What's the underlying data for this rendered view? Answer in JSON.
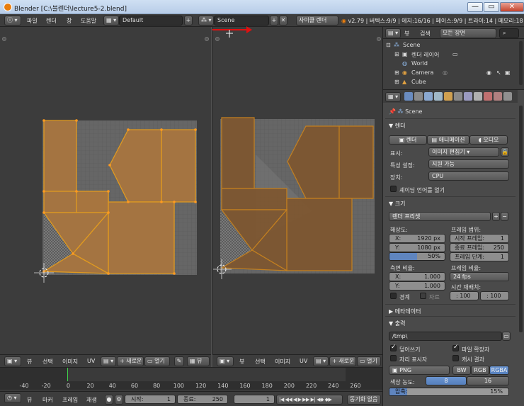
{
  "window": {
    "title": "Blender [C:\\블렌더\\lecture5-2.blend]",
    "min": "—",
    "max": "▭",
    "close": "✕"
  },
  "info": {
    "menu": [
      "파일",
      "렌더",
      "창",
      "도움말"
    ],
    "screen_layout": "Default",
    "scene": "Scene",
    "engine": "사이클 렌더",
    "stats": "v2.79 | 버텍스:9/9 | 에지:16/16 | 페이스:9/9 | 트라이:14 | 메모리:18"
  },
  "viewport_left": {
    "menu": [
      "뷰",
      "선택",
      "이미지",
      "UV"
    ],
    "new_label": "새로운",
    "open_label": "열기"
  },
  "viewport_right": {
    "view_label": "뷰",
    "new_label": "새로운",
    "open_label": "열기"
  },
  "timeline": {
    "ticks": [
      "-40",
      "-20",
      "0",
      "20",
      "40",
      "60",
      "80",
      "100",
      "120",
      "140",
      "160",
      "180",
      "200",
      "220",
      "240",
      "260"
    ],
    "menu": [
      "뷰",
      "마커",
      "프레임",
      "재생"
    ],
    "start_label": "시작:",
    "start_value": "1",
    "end_label": "종료:",
    "end_value": "250",
    "current_value": "1",
    "sync": "동기화 없음"
  },
  "outliner": {
    "view": "뷰",
    "search": "검색",
    "filter": "모든 장면",
    "rows": [
      "Scene",
      "렌더 레이어",
      "World",
      "Camera",
      "Cube"
    ]
  },
  "properties": {
    "context": "Scene",
    "render_panel": "렌더",
    "render_btn": "렌더",
    "anim_btn": "애니메이션",
    "audio_btn": "오디오",
    "display_label": "표시:",
    "display_value": "이미지 편집기",
    "feature_label": "특성 설정:",
    "feature_value": "지원 가능",
    "device_label": "장치:",
    "device_value": "CPU",
    "osl_label": "셰이딩 언어를 열기",
    "dim_panel": "크기",
    "render_preset": "렌더 프리셋",
    "resolution_label": "해상도:",
    "res_x_label": "X:",
    "res_x": "1920 px",
    "res_y_label": "Y:",
    "res_y": "1080 px",
    "res_pct": "50%",
    "frame_range_label": "프레임 범위:",
    "start_frame_label": "시작 프레임:",
    "start_frame": "1",
    "end_frame_label": "종료 프레임:",
    "end_frame": "250",
    "frame_step_label": "프레임 단계:",
    "frame_step": "1",
    "aspect_label": "측면 비율:",
    "asp_x_label": "X:",
    "asp_x": "1.000",
    "asp_y_label": "Y:",
    "asp_y": "1.000",
    "fps_label": "프레임 비율:",
    "fps": "24 fps",
    "remap_label": "시간 재배치:",
    "remap_old": ": 100",
    "remap_new": ": 100",
    "border_label": "경계",
    "crop_label": "자르",
    "metadata_panel": "메타데이터",
    "output_panel": "출력",
    "output_path": "/tmp\\",
    "overwrite_label": "덮어쓰기",
    "file_ext_label": "파일 확장자",
    "placeholders_label": "자리 표시자",
    "cache_label": "캐시 결과",
    "format": "PNG",
    "bw": "BW",
    "rgb": "RGB",
    "rgba": "RGBA",
    "color_depth_label": "색상 농도:",
    "depth_8": "8",
    "depth_16": "16",
    "compression_label": "압축:",
    "compression_value": "15%",
    "compression_fraction": 0.15
  },
  "colors": {
    "accent_blue": "#5680bd",
    "orange_face": "#a8753f",
    "orange_edge": "#e09a20",
    "grid_gray": "#6a6a6a"
  }
}
